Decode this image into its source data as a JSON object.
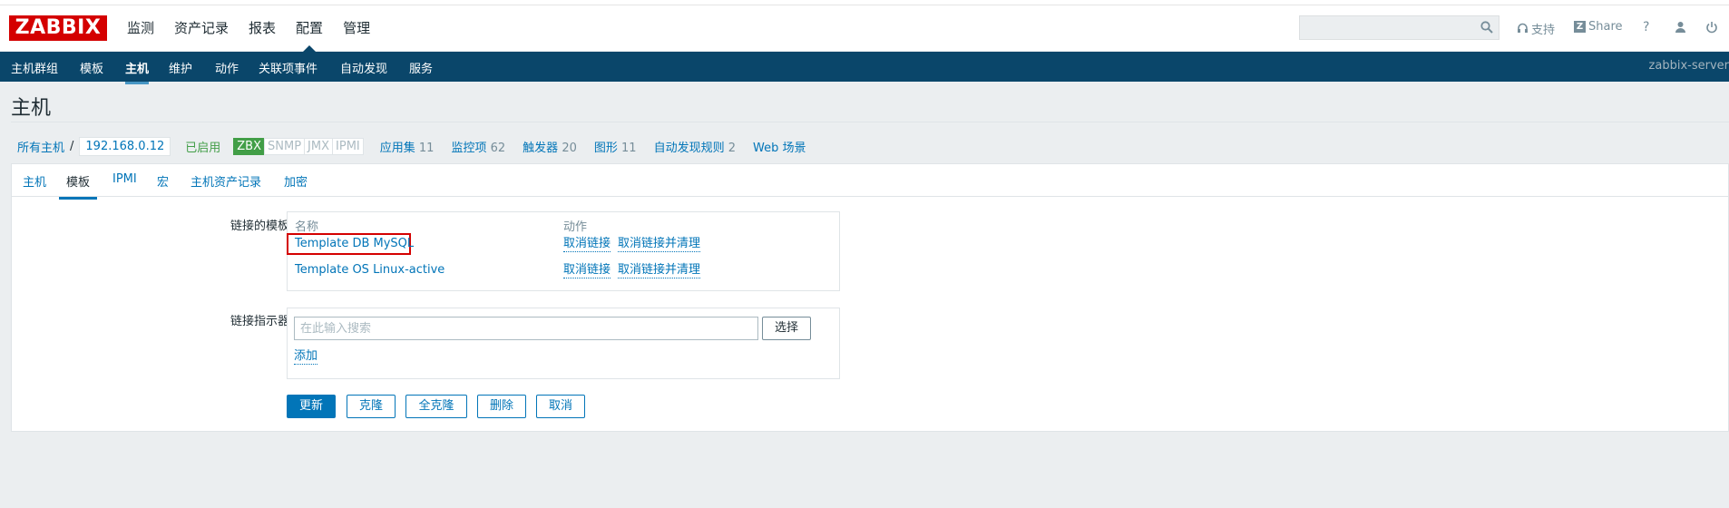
{
  "app": {
    "logo": "ZABBIX",
    "server_name": "zabbix-server"
  },
  "main_menu": [
    {
      "label": "监测",
      "active": false
    },
    {
      "label": "资产记录",
      "active": false
    },
    {
      "label": "报表",
      "active": false
    },
    {
      "label": "配置",
      "active": true
    },
    {
      "label": "管理",
      "active": false
    }
  ],
  "header": {
    "search": {
      "value": "",
      "placeholder": ""
    },
    "support_label": "支持",
    "share_label": "Share",
    "help_icon": "question-mark-icon",
    "user_icon": "user-icon",
    "logout_icon": "power-icon"
  },
  "sub_menu": [
    {
      "label": "主机群组",
      "active": false
    },
    {
      "label": "模板",
      "active": false
    },
    {
      "label": "主机",
      "active": true
    },
    {
      "label": "维护",
      "active": false
    },
    {
      "label": "动作",
      "active": false
    },
    {
      "label": "关联项事件",
      "active": false
    },
    {
      "label": "自动发现",
      "active": false
    },
    {
      "label": "服务",
      "active": false
    }
  ],
  "page": {
    "title": "主机"
  },
  "breadcrumb": {
    "all_hosts": "所有主机",
    "separator": "/",
    "host": "192.168.0.12",
    "status": "已启用",
    "availability": [
      "ZBX",
      "SNMP",
      "JMX",
      "IPMI"
    ],
    "items": [
      {
        "label": "应用集",
        "count": "11"
      },
      {
        "label": "监控项",
        "count": "62"
      },
      {
        "label": "触发器",
        "count": "20"
      },
      {
        "label": "图形",
        "count": "11"
      },
      {
        "label": "自动发现规则",
        "count": "2"
      },
      {
        "label": "Web 场景",
        "count": ""
      }
    ]
  },
  "tabs": [
    {
      "label": "主机",
      "active": false
    },
    {
      "label": "模板",
      "active": true
    },
    {
      "label": "IPMI",
      "active": false
    },
    {
      "label": "宏",
      "active": false
    },
    {
      "label": "主机资产记录",
      "active": false
    },
    {
      "label": "加密",
      "active": false
    }
  ],
  "linked_templates": {
    "label": "链接的模板",
    "col_name": "名称",
    "col_action": "动作",
    "rows": [
      {
        "name": "Template DB MySQL",
        "unlink": "取消链接",
        "unlink_clear": "取消链接并清理",
        "highlighted": true
      },
      {
        "name": "Template OS Linux-active",
        "unlink": "取消链接",
        "unlink_clear": "取消链接并清理",
        "highlighted": false
      }
    ]
  },
  "link_new": {
    "label": "链接指示器",
    "input_placeholder": "在此输入搜索",
    "input_value": "",
    "select_button": "选择",
    "add_link": "添加"
  },
  "buttons": {
    "update": "更新",
    "clone": "克隆",
    "full_clone": "全克隆",
    "delete": "删除",
    "cancel": "取消"
  },
  "colors": {
    "brand_red": "#d40000",
    "nav_blue": "#0a466a",
    "link_blue": "#0275b8",
    "enabled_green": "#429e47"
  }
}
